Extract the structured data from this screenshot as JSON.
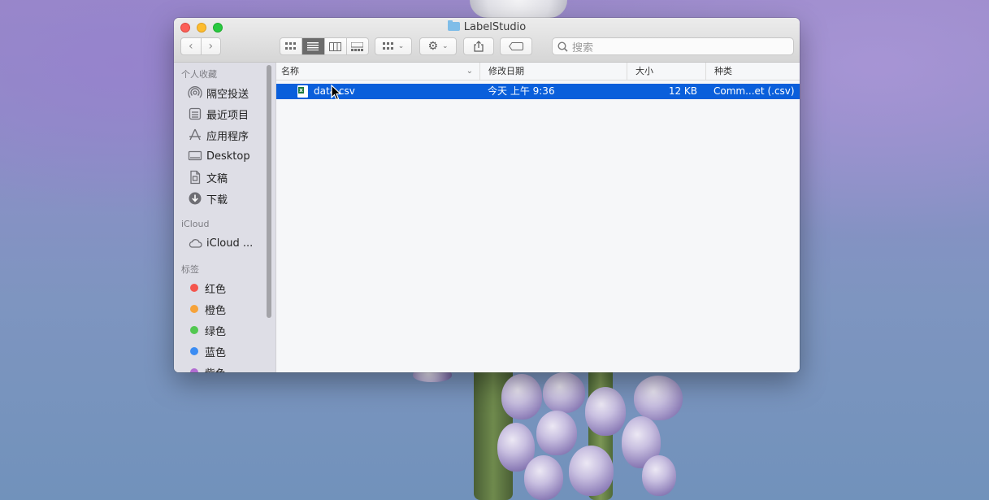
{
  "window": {
    "title": "LabelStudio"
  },
  "toolbar": {
    "search_placeholder": "搜索"
  },
  "sidebar": {
    "favorites_header": "个人收藏",
    "favorites": [
      {
        "label": "隔空投送",
        "icon": "airdrop-icon"
      },
      {
        "label": "最近项目",
        "icon": "recents-icon"
      },
      {
        "label": "应用程序",
        "icon": "applications-icon"
      },
      {
        "label": "Desktop",
        "icon": "desktop-icon"
      },
      {
        "label": "文稿",
        "icon": "documents-icon"
      },
      {
        "label": "下载",
        "icon": "downloads-icon"
      }
    ],
    "icloud_header": "iCloud",
    "icloud_items": [
      {
        "label": "iCloud ...",
        "icon": "cloud-icon"
      }
    ],
    "tags_header": "标签",
    "tags": [
      {
        "label": "红色",
        "color": "#f4554d"
      },
      {
        "label": "橙色",
        "color": "#f6a33a"
      },
      {
        "label": "绿色",
        "color": "#52c851"
      },
      {
        "label": "蓝色",
        "color": "#3b8cf3"
      },
      {
        "label": "紫色",
        "color": "#b26cd2"
      }
    ]
  },
  "columns": {
    "name": "名称",
    "date": "修改日期",
    "size": "大小",
    "kind": "种类"
  },
  "files": [
    {
      "name": "data.csv",
      "date": "今天 上午 9:36",
      "size": "12 KB",
      "kind": "Comm...et (.csv)"
    }
  ],
  "colors": {
    "selection": "#0a5fdb",
    "sidebar_bg": "#dedee6"
  }
}
